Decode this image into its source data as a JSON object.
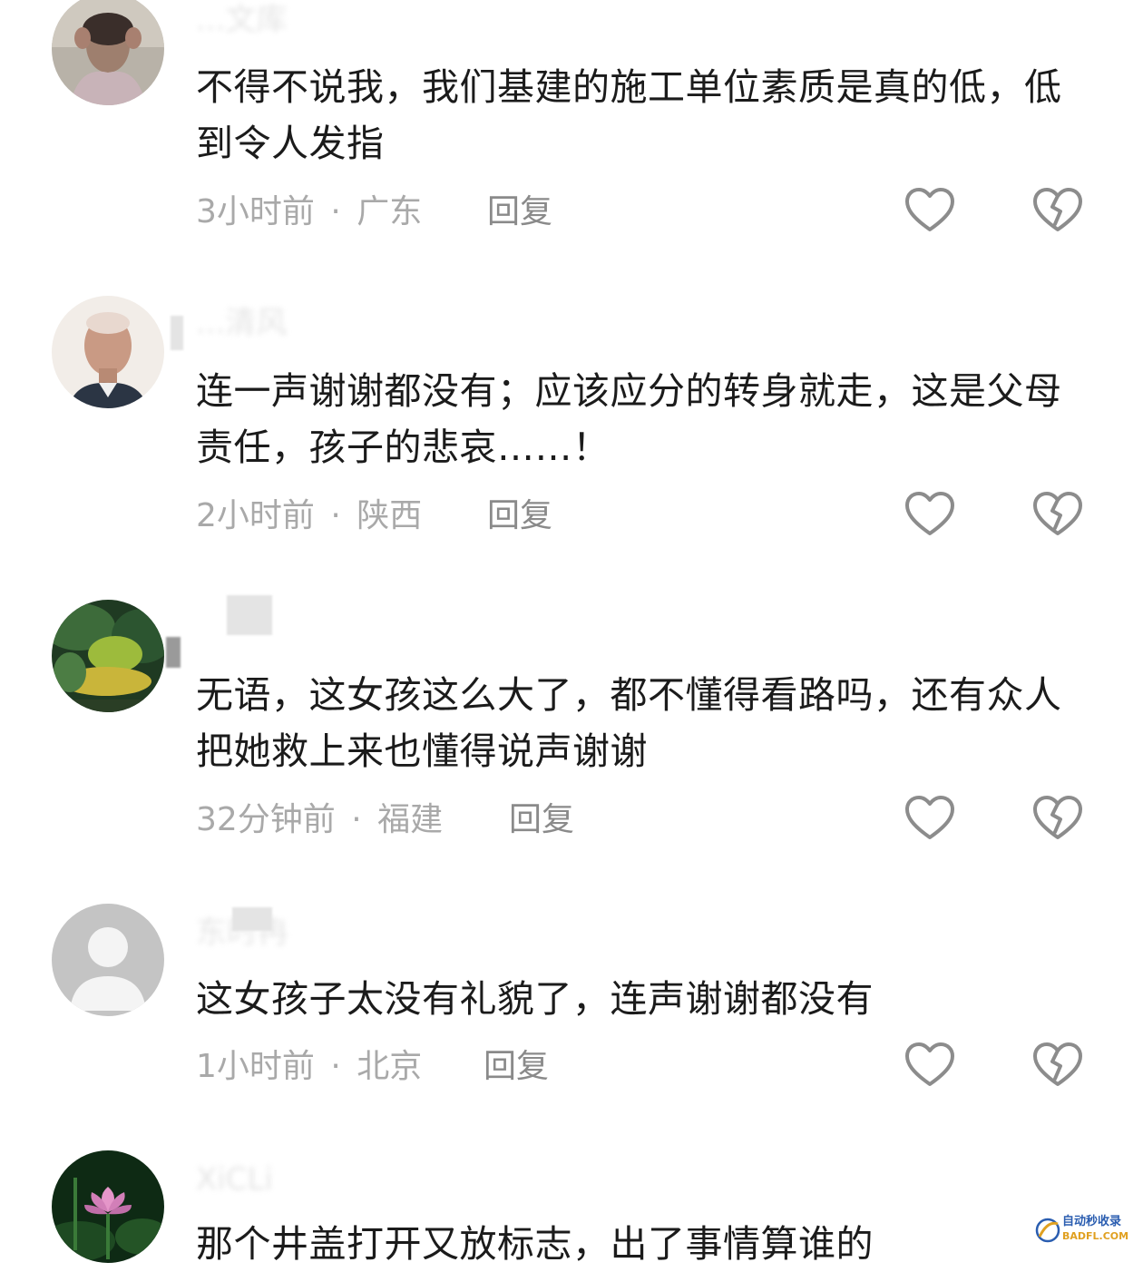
{
  "comments": [
    {
      "username": "...文库",
      "text": "不得不说我，我们基建的施工单位素质是真的低，低到令人发指",
      "time": "3小时前",
      "separator": "·",
      "location": "广东",
      "reply_label": "回复",
      "like_icon": "heart-outline-icon",
      "dislike_icon": "broken-heart-icon"
    },
    {
      "username": "...清风",
      "text": "连一声谢谢都没有；应该应分的转身就走，这是父母责任，孩子的悲哀……！",
      "time": "2小时前",
      "separator": "·",
      "location": "陕西",
      "reply_label": "回复",
      "like_icon": "heart-outline-icon",
      "dislike_icon": "broken-heart-icon"
    },
    {
      "username": "",
      "text": "无语，这女孩这么大了，都不懂得看路吗，还有众人把她救上来也懂得说声谢谢",
      "time": "32分钟前",
      "separator": "·",
      "location": "福建",
      "reply_label": "回复",
      "like_icon": "heart-outline-icon",
      "dislike_icon": "broken-heart-icon"
    },
    {
      "username": "东时冉",
      "text": "这女孩子太没有礼貌了，连声谢谢都没有",
      "time": "1小时前",
      "separator": "·",
      "location": "北京",
      "reply_label": "回复",
      "like_icon": "heart-outline-icon",
      "dislike_icon": "broken-heart-icon"
    },
    {
      "username": "XiCLi",
      "text": "那个井盖打开又放标志，出了事情算谁的",
      "time": "",
      "separator": "",
      "location": "",
      "reply_label": "",
      "like_icon": "",
      "dislike_icon": ""
    }
  ],
  "watermark": {
    "line1": "自动秒收录",
    "line2": "BADFL.COM"
  },
  "colors": {
    "text": "#1b1b1b",
    "meta": "#a9a9a9",
    "reply": "#8a8a8a",
    "icon": "#8c8c8c"
  }
}
